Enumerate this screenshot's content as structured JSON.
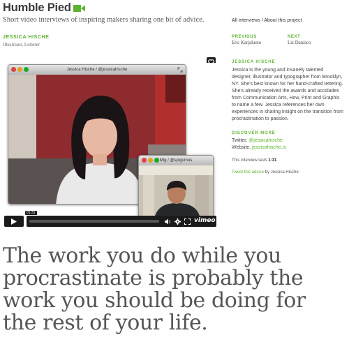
{
  "site": {
    "title": "Humble Pied",
    "tagline": "Short video interviews of inspiring makers sharing one bit of advice."
  },
  "person": {
    "name": "JESSICA HISCHE",
    "role": "Illustrator, Letterer"
  },
  "topnav": {
    "all_interviews": "All interviews",
    "separator": "/",
    "about": "About this project"
  },
  "prevnext": {
    "previous_label": "PREVIOUS",
    "previous_name": "Eric Karjaluoto",
    "next_label": "NEXT",
    "next_name": "Liz Danzico"
  },
  "share_icons": [
    "heart-icon",
    "clock-icon",
    "send-icon"
  ],
  "video": {
    "window1_title": "Jessica Hische / @jessicahische",
    "window2_title": "Mig / @spigumus",
    "time_label": "01:31",
    "vimeo_label": "vimeo"
  },
  "sidebar": {
    "name_heading": "JESSICA HISCHE",
    "bio": "Jessica is the young and insanely talented designer, illustrator and typographer from Brooklyn, NY. She's best known for her hand-crafted lettering. She's already received the awards and accolades from Communication Arts, How, Print and Graphis to name a few. Jessica references her own experiences in sharing insight on the transition from procrastination to passion.",
    "discover_heading": "DISCOVER MORE",
    "twitter_label": "Twitter, ",
    "twitter_handle": "@jessicahische",
    "website_label": "Website, ",
    "website_url": "jessicahische.is",
    "lasts_prefix": "This interview lasts ",
    "lasts_time": "1:31",
    "tweet_link": "Tweet this advice",
    "tweet_suffix": " by Jessica Hische."
  },
  "quote": "The work you do while you procrastinate is probably the work you should be doing for the rest of your life.",
  "colors": {
    "accent": "#5fb231",
    "text": "#333333",
    "quote": "#555555",
    "player": "#1b1b1b"
  }
}
